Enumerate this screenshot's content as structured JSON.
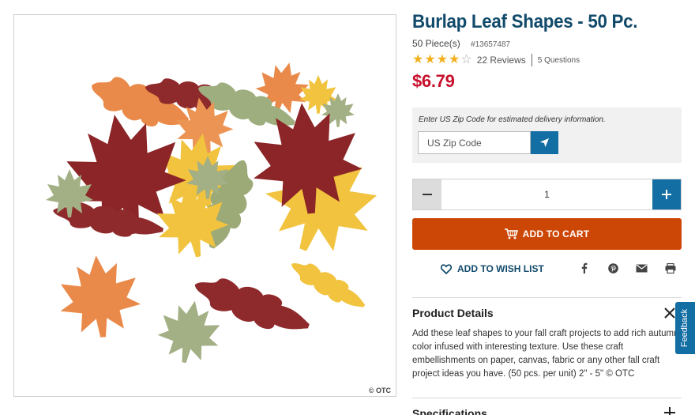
{
  "product": {
    "title": "Burlap Leaf Shapes - 50 Pc.",
    "pieces": "50 Piece(s)",
    "sku": "#13657487",
    "rating": 4,
    "rating_max": 5,
    "reviews": "22 Reviews",
    "questions": "5 Questions",
    "price": "$6.79",
    "image_copyright": "© OTC"
  },
  "delivery": {
    "note": "Enter US Zip Code for estimated delivery information.",
    "zip_placeholder": "US Zip Code"
  },
  "quantity": {
    "value": "1"
  },
  "actions": {
    "add_to_cart": "ADD TO CART",
    "add_to_wish_list": "ADD TO WISH LIST"
  },
  "share_icons": [
    "facebook-icon",
    "pinterest-icon",
    "email-icon",
    "print-icon"
  ],
  "details": {
    "title": "Product Details",
    "body": "Add these leaf shapes to your fall craft projects to add rich autumn color infused with interesting texture. Use these craft embellishments on paper, canvas, fabric or any other fall craft project ideas you have. (50 pcs. per unit) 2\" - 5\" © OTC"
  },
  "specifications": {
    "title": "Specifications"
  },
  "feedback": {
    "label": "Feedback"
  },
  "colors": {
    "brand_blue": "#114a6b",
    "button_blue": "#136ea3",
    "price_red": "#c8102e",
    "cart_orange": "#cc4606",
    "star_gold": "#f2b01e"
  }
}
